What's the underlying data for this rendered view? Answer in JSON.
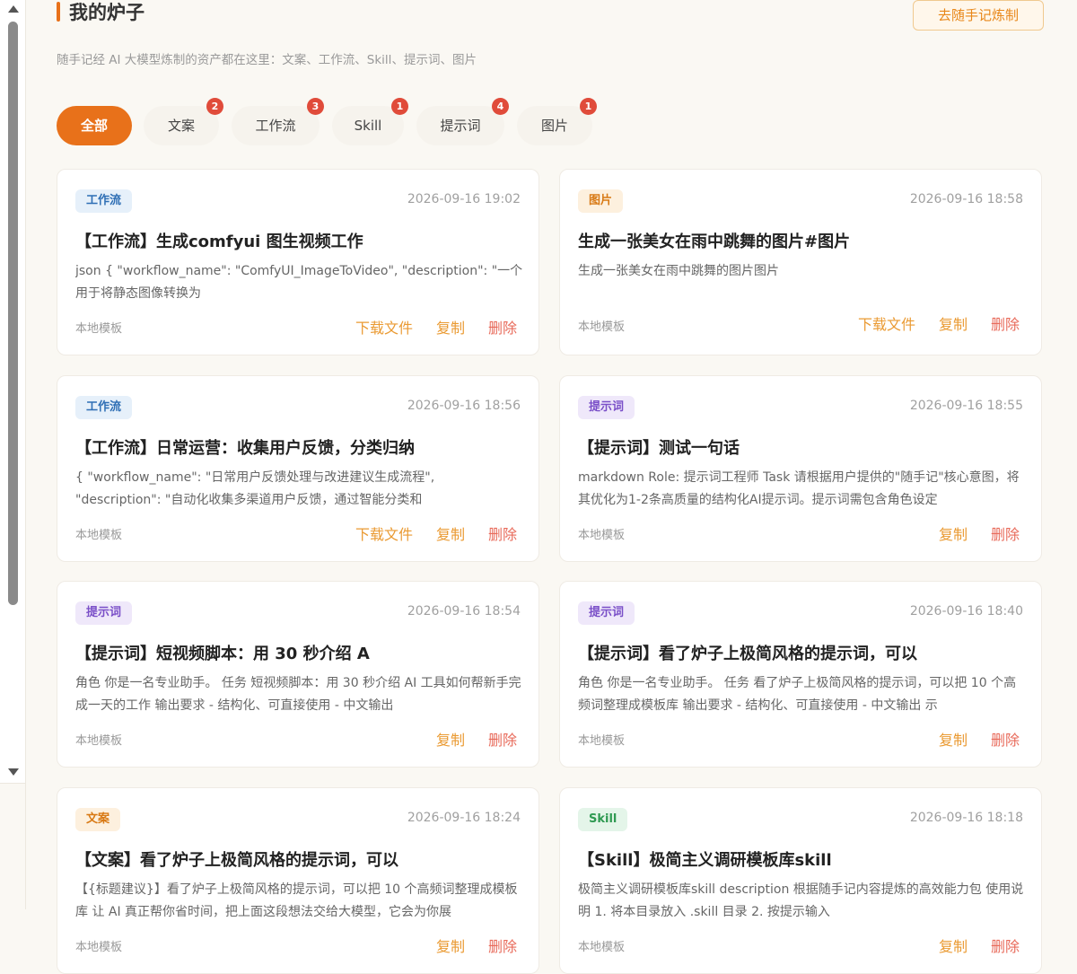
{
  "header": {
    "title": "我的炉子",
    "subtitle": "随手记经 AI 大模型炼制的资产都在这里：文案、工作流、Skill、提示词、图片",
    "action_label": "去随手记炼制"
  },
  "tabs": [
    {
      "label": "全部",
      "active": true
    },
    {
      "label": "文案",
      "badge": "2"
    },
    {
      "label": "工作流",
      "badge": "3"
    },
    {
      "label": "Skill",
      "badge": "1"
    },
    {
      "label": "提示词",
      "badge": "4"
    },
    {
      "label": "图片",
      "badge": "1"
    }
  ],
  "cards": [
    {
      "tag": "工作流",
      "time": "2026-09-16 19:02",
      "title": "【工作流】生成comfyui 图生视频工作",
      "desc": "json { \"workflow_name\": \"ComfyUI_ImageToVideo\", \"description\": \"一个用于将静态图像转换为",
      "source": "本地模板",
      "actions": [
        "下载文件",
        "复制",
        "删除"
      ]
    },
    {
      "tag": "图片",
      "time": "2026-09-16 18:58",
      "title": "生成一张美女在雨中跳舞的图片#图片",
      "desc": "生成一张美女在雨中跳舞的图片图片",
      "source": "本地模板",
      "actions": [
        "下载文件",
        "复制",
        "删除"
      ]
    },
    {
      "tag": "工作流",
      "time": "2026-09-16 18:56",
      "title": "【工作流】日常运营：收集用户反馈，分类归纳",
      "desc": "{ \"workflow_name\": \"日常用户反馈处理与改进建议生成流程\", \"description\": \"自动化收集多渠道用户反馈，通过智能分类和",
      "source": "本地模板",
      "actions": [
        "下载文件",
        "复制",
        "删除"
      ]
    },
    {
      "tag": "提示词",
      "time": "2026-09-16 18:55",
      "title": "【提示词】测试一句话",
      "desc": "markdown Role: 提示词工程师 Task 请根据用户提供的\"随手记\"核心意图，将其优化为1-2条高质量的结构化AI提示词。提示词需包含角色设定",
      "source": "本地模板",
      "actions": [
        "复制",
        "删除"
      ]
    },
    {
      "tag": "提示词",
      "time": "2026-09-16 18:54",
      "title": "【提示词】短视频脚本：用 30 秒介绍 A",
      "desc": "角色 你是一名专业助手。 任务 短视频脚本：用 30 秒介绍 AI 工具如何帮新手完成一天的工作 输出要求 - 结构化、可直接使用 - 中文输出",
      "source": "本地模板",
      "actions": [
        "复制",
        "删除"
      ]
    },
    {
      "tag": "提示词",
      "time": "2026-09-16 18:40",
      "title": "【提示词】看了炉子上极简风格的提示词，可以",
      "desc": "角色 你是一名专业助手。 任务 看了炉子上极简风格的提示词，可以把 10 个高频词整理成模板库 输出要求 - 结构化、可直接使用 - 中文输出 示",
      "source": "本地模板",
      "actions": [
        "复制",
        "删除"
      ]
    },
    {
      "tag": "文案",
      "time": "2026-09-16 18:24",
      "title": "【文案】看了炉子上极简风格的提示词，可以",
      "desc": "【{标题建议}】看了炉子上极简风格的提示词，可以把 10 个高频词整理成模板库 让 AI 真正帮你省时间，把上面这段想法交给大模型，它会为你展",
      "source": "本地模板",
      "actions": [
        "复制",
        "删除"
      ]
    },
    {
      "tag": "Skill",
      "time": "2026-09-16 18:18",
      "title": "【Skill】极简主义调研模板库skill",
      "desc": "极简主义调研模板库skill description 根据随手记内容提炼的高效能力包 使用说明 1. 将本目录放入 .skill 目录 2. 按提示输入",
      "source": "本地模板",
      "actions": [
        "复制",
        "删除"
      ]
    }
  ]
}
